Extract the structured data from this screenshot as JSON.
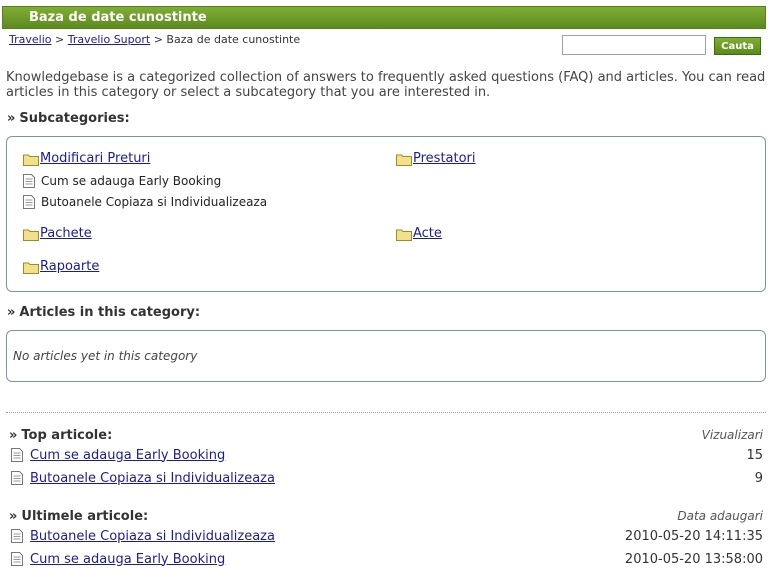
{
  "header": {
    "title": "Baza de date cunostinte"
  },
  "breadcrumb": {
    "items": [
      "Travelio",
      "Travelio Suport",
      "Baza de date cunostinte"
    ],
    "separator": ">"
  },
  "search": {
    "value": "",
    "button_label": "Cauta"
  },
  "intro": "Knowledgebase is a categorized collection of answers to frequently asked questions (FAQ) and articles. You can read articles in this category or select a subcategory that you are interested in.",
  "subcategories": {
    "heading": "Subcategories:",
    "items": [
      {
        "label": "Modificari Preturi",
        "icon": "folder-icon"
      },
      {
        "label": "Prestatori",
        "icon": "folder-icon"
      },
      {
        "label": "Cum se adauga Early Booking",
        "icon": "document-icon"
      },
      {
        "label": "Butoanele Copiaza si Individualizeaza",
        "icon": "document-icon"
      },
      {
        "label": "Pachete",
        "icon": "folder-icon"
      },
      {
        "label": "Acte",
        "icon": "folder-icon"
      },
      {
        "label": "Rapoarte",
        "icon": "folder-icon"
      }
    ]
  },
  "articles": {
    "heading": "Articles in this category:",
    "empty_text": "No articles yet in this category"
  },
  "top_articles": {
    "heading": "Top articole:",
    "column_label": "Vizualizari",
    "rows": [
      {
        "title": "Cum se adauga Early Booking",
        "value": "15"
      },
      {
        "title": "Butoanele Copiaza si Individualizeaza",
        "value": "9"
      }
    ]
  },
  "latest_articles": {
    "heading": "Ultimele articole:",
    "column_label": "Data adaugari",
    "rows": [
      {
        "title": "Butoanele Copiaza si Individualizeaza",
        "value": "2010-05-20 14:11:35"
      },
      {
        "title": "Cum se adauga Early Booking",
        "value": "2010-05-20 13:58:00"
      }
    ]
  },
  "colors": {
    "header_green": "#6f9a2c",
    "link_blue": "#1b1b9e",
    "box_border": "#7b93a8",
    "folder_yellow": "#f3e08a"
  }
}
